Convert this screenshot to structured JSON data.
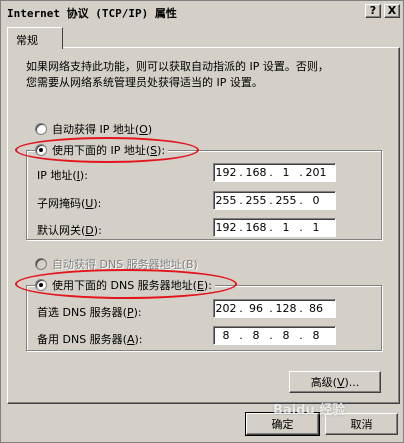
{
  "window": {
    "title": "Internet 协议 (TCP/IP) 属性",
    "help_btn": "?",
    "close_btn": "X"
  },
  "tab": {
    "label": "常规"
  },
  "description": {
    "line1": "如果网络支持此功能，则可以获取自动指派的 IP 设置。否则，",
    "line2": "您需要从网络系统管理员处获得适当的 IP 设置。"
  },
  "ip_mode": {
    "auto_pre": "自动获得 IP 地址(",
    "auto_key": "O",
    "auto_post": ")",
    "manual_pre": "使用下面的 IP 地址(",
    "manual_key": "S",
    "manual_post": "):",
    "selected": "manual"
  },
  "ip_fields": {
    "ip": {
      "pre": "IP 地址(",
      "key": "I",
      "post": "):",
      "octets": [
        "192",
        "168",
        "1",
        "201"
      ]
    },
    "mask": {
      "pre": "子网掩码(",
      "key": "U",
      "post": "):",
      "octets": [
        "255",
        "255",
        "255",
        "0"
      ]
    },
    "gateway": {
      "pre": "默认网关(",
      "key": "D",
      "post": "):",
      "octets": [
        "192",
        "168",
        "1",
        "1"
      ]
    }
  },
  "dns_mode": {
    "auto_label": "自动获得 DNS 服务器地址(B)",
    "manual_pre": "使用下面的 DNS 服务器地址(",
    "manual_key": "E",
    "manual_post": "):",
    "selected": "manual"
  },
  "dns_fields": {
    "preferred": {
      "pre": "首选 DNS 服务器(",
      "key": "P",
      "post": "):",
      "octets": [
        "202",
        "96",
        "128",
        "86"
      ]
    },
    "alternate": {
      "pre": "备用 DNS 服务器(",
      "key": "A",
      "post": "):",
      "octets": [
        "8",
        "8",
        "8",
        "8"
      ]
    }
  },
  "buttons": {
    "advanced_pre": "高级(",
    "advanced_key": "V",
    "advanced_post": ")...",
    "ok": "确定",
    "cancel": "取消"
  },
  "watermark": "Baidu 经验",
  "colors": {
    "annotation_red": "#e2141c",
    "dialog_gray": "#d4d0c8"
  }
}
